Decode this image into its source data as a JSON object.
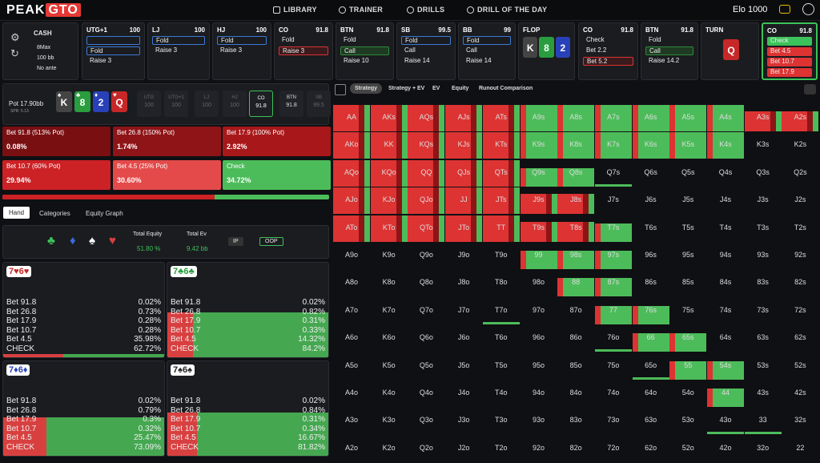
{
  "brand": {
    "a": "PEAK",
    "b": "GTO"
  },
  "nav": [
    "LIBRARY",
    "TRAINER",
    "DRILLS",
    "DRILL OF THE DAY"
  ],
  "elo": "Elo 1000",
  "game": {
    "type": "CASH",
    "players": "8Max",
    "stack": "100 bb",
    "ante": "No ante"
  },
  "actions": [
    {
      "pos": "UTG+1",
      "stack": "100",
      "opts": [
        {
          "l": "",
          "c": "sel"
        },
        {
          "l": "Fold",
          "c": "sel"
        },
        {
          "l": "Raise 3",
          "c": ""
        }
      ]
    },
    {
      "pos": "LJ",
      "stack": "100",
      "opts": [
        {
          "l": "Fold",
          "c": "sel"
        },
        {
          "l": "Raise 3",
          "c": ""
        }
      ]
    },
    {
      "pos": "HJ",
      "stack": "100",
      "opts": [
        {
          "l": "Fold",
          "c": "sel"
        },
        {
          "l": "Raise 3",
          "c": ""
        }
      ]
    },
    {
      "pos": "CO",
      "stack": "91.8",
      "opts": [
        {
          "l": "Fold",
          "c": ""
        },
        {
          "l": "Raise 3",
          "c": "selr"
        }
      ]
    },
    {
      "pos": "BTN",
      "stack": "91.8",
      "opts": [
        {
          "l": "Fold",
          "c": ""
        },
        {
          "l": "Call",
          "c": "selg"
        },
        {
          "l": "Raise 10",
          "c": ""
        }
      ]
    },
    {
      "pos": "SB",
      "stack": "99.5",
      "opts": [
        {
          "l": "Fold",
          "c": "sel"
        },
        {
          "l": "Call",
          "c": ""
        },
        {
          "l": "Raise 14",
          "c": ""
        }
      ]
    },
    {
      "pos": "BB",
      "stack": "99",
      "opts": [
        {
          "l": "Fold",
          "c": "sel"
        },
        {
          "l": "Call",
          "c": ""
        },
        {
          "l": "Raise 14",
          "c": ""
        }
      ]
    },
    {
      "pos": "FLOP",
      "stack": "",
      "opts": []
    },
    {
      "pos": "CO",
      "stack": "91.8",
      "opts": [
        {
          "l": "Check",
          "c": ""
        },
        {
          "l": "Bet 2.2",
          "c": ""
        },
        {
          "l": "Bet 5.2",
          "c": "selr"
        }
      ]
    },
    {
      "pos": "BTN",
      "stack": "91.8",
      "opts": [
        {
          "l": "Fold",
          "c": ""
        },
        {
          "l": "Call",
          "c": "selg"
        },
        {
          "l": "Raise 14.2",
          "c": ""
        }
      ]
    },
    {
      "pos": "TURN",
      "stack": "",
      "opts": []
    },
    {
      "pos": "CO",
      "stack": "91.8",
      "opts": [
        {
          "l": "Check",
          "c": "g"
        },
        {
          "l": "Bet 4.5",
          "c": "r"
        },
        {
          "l": "Bet 10.7",
          "c": "r"
        },
        {
          "l": "Bet 17.9",
          "c": "r"
        }
      ]
    }
  ],
  "pot": {
    "label": "Pot",
    "value": "17.90bb",
    "spr": "SPR: 5.13"
  },
  "board": [
    "K",
    "8",
    "2",
    "Q"
  ],
  "positions": [
    {
      "n": "UTG",
      "s": "100"
    },
    {
      "n": "UTG+1",
      "s": "100"
    },
    {
      "n": "LJ",
      "s": "100"
    },
    {
      "n": "HJ",
      "s": "100"
    },
    {
      "n": "CO",
      "s": "91.8"
    },
    {
      "n": "BTN",
      "s": "91.8"
    },
    {
      "n": "SB",
      "s": "99.5"
    },
    {
      "n": "BB",
      "s": "99"
    }
  ],
  "bets": [
    {
      "l": "Bet 91.8 (513% Pot)",
      "p": "0.08%",
      "c": "#7a0f12"
    },
    {
      "l": "Bet 26.8 (150% Pot)",
      "p": "1.74%",
      "c": "#8e1417"
    },
    {
      "l": "Bet 17.9 (100% Pot)",
      "p": "2.92%",
      "c": "#a8181b"
    },
    {
      "l": "Bet 10.7 (60% Pot)",
      "p": "29.94%",
      "c": "#cc2125"
    },
    {
      "l": "Bet 4.5 (25% Pot)",
      "p": "30.60%",
      "c": "#e44a4a"
    },
    {
      "l": "Check",
      "p": "34.72%",
      "c": "#4cbc5a"
    }
  ],
  "tabs": [
    "Hand",
    "Categories",
    "Equity Graph"
  ],
  "stats": {
    "te_label": "Total Equity",
    "te": "51.80 %",
    "tev_label": "Total Ev",
    "tev": "9.42 bb",
    "ip": "IP",
    "oop": "OOP"
  },
  "strat_tabs": [
    "Strategy",
    "Strategy + EV",
    "EV",
    "Equity",
    "Runout Comparison"
  ],
  "hands": [
    {
      "name": "7♥6♥",
      "rows": [
        [
          "Bet 91.8",
          "0.02%"
        ],
        [
          "Bet 26.8",
          "0.73%"
        ],
        [
          "Bet 17.9",
          "0.28%"
        ],
        [
          "Bet 10.7",
          "0.28%"
        ],
        [
          "Bet 4.5",
          "35.98%"
        ],
        [
          "CHECK",
          "62.72%"
        ]
      ],
      "check": 0.627
    },
    {
      "name": "7♣6♣",
      "rows": [
        [
          "Bet 91.8",
          "0.02%"
        ],
        [
          "Bet 26.8",
          "0.82%"
        ],
        [
          "Bet 17.9",
          "0.31%"
        ],
        [
          "Bet 10.7",
          "0.33%"
        ],
        [
          "Bet 4.5",
          "14.32%"
        ],
        [
          "CHECK",
          "84.2%"
        ]
      ],
      "check": 0.842
    },
    {
      "name": "7♦6♦",
      "rows": [
        [
          "Bet 91.8",
          "0.02%"
        ],
        [
          "Bet 26.8",
          "0.79%"
        ],
        [
          "Bet 17.9",
          "0.3%"
        ],
        [
          "Bet 10.7",
          "0.32%"
        ],
        [
          "Bet 4.5",
          "25.47%"
        ],
        [
          "CHECK",
          "73.09%"
        ]
      ],
      "check": 0.731
    },
    {
      "name": "7♠6♠",
      "rows": [
        [
          "Bet 91.8",
          "0.02%"
        ],
        [
          "Bet 26.8",
          "0.84%"
        ],
        [
          "Bet 17.9",
          "0.31%"
        ],
        [
          "Bet 10.7",
          "0.34%"
        ],
        [
          "Bet 4.5",
          "16.67%"
        ],
        [
          "CHECK",
          "81.82%"
        ]
      ],
      "check": 0.818
    }
  ],
  "grid": [
    [
      "AA",
      "AKs",
      "AQs",
      "AJs",
      "ATs",
      "A9s",
      "A8s",
      "A7s",
      "A6s",
      "A5s",
      "A4s",
      "A3s",
      "A2s"
    ],
    [
      "AKo",
      "KK",
      "KQs",
      "KJs",
      "KTs",
      "K9s",
      "K8s",
      "K7s",
      "K6s",
      "K5s",
      "K4s",
      "K3s",
      "K2s"
    ],
    [
      "AQo",
      "KQo",
      "QQ",
      "QJs",
      "QTs",
      "Q9s",
      "Q8s",
      "Q7s",
      "Q6s",
      "Q5s",
      "Q4s",
      "Q3s",
      "Q2s"
    ],
    [
      "AJo",
      "KJo",
      "QJo",
      "JJ",
      "JTs",
      "J9s",
      "J8s",
      "J7s",
      "J6s",
      "J5s",
      "J4s",
      "J3s",
      "J2s"
    ],
    [
      "ATo",
      "KTo",
      "QTo",
      "JTo",
      "TT",
      "T9s",
      "T8s",
      "T7s",
      "T6s",
      "T5s",
      "T4s",
      "T3s",
      "T2s"
    ],
    [
      "A9o",
      "K9o",
      "Q9o",
      "J9o",
      "T9o",
      "99",
      "98s",
      "97s",
      "96s",
      "95s",
      "94s",
      "93s",
      "92s"
    ],
    [
      "A8o",
      "K8o",
      "Q8o",
      "J8o",
      "T8o",
      "98o",
      "88",
      "87s",
      "86s",
      "85s",
      "84s",
      "83s",
      "82s"
    ],
    [
      "A7o",
      "K7o",
      "Q7o",
      "J7o",
      "T7o",
      "97o",
      "87o",
      "77",
      "76s",
      "75s",
      "74s",
      "73s",
      "72s"
    ],
    [
      "A6o",
      "K6o",
      "Q6o",
      "J6o",
      "T6o",
      "96o",
      "86o",
      "76o",
      "66",
      "65s",
      "64s",
      "63s",
      "62s"
    ],
    [
      "A5o",
      "K5o",
      "Q5o",
      "J5o",
      "T5o",
      "95o",
      "85o",
      "75o",
      "65o",
      "55",
      "54s",
      "53s",
      "52s"
    ],
    [
      "A4o",
      "K4o",
      "Q4o",
      "J4o",
      "T4o",
      "94o",
      "84o",
      "74o",
      "64o",
      "54o",
      "44",
      "43s",
      "42s"
    ],
    [
      "A3o",
      "K3o",
      "Q3o",
      "J3o",
      "T3o",
      "93o",
      "83o",
      "73o",
      "63o",
      "53o",
      "43o",
      "33",
      "32s"
    ],
    [
      "A2o",
      "K2o",
      "Q2o",
      "J2o",
      "T2o",
      "92o",
      "82o",
      "72o",
      "62o",
      "52o",
      "42o",
      "32o",
      "22"
    ]
  ]
}
